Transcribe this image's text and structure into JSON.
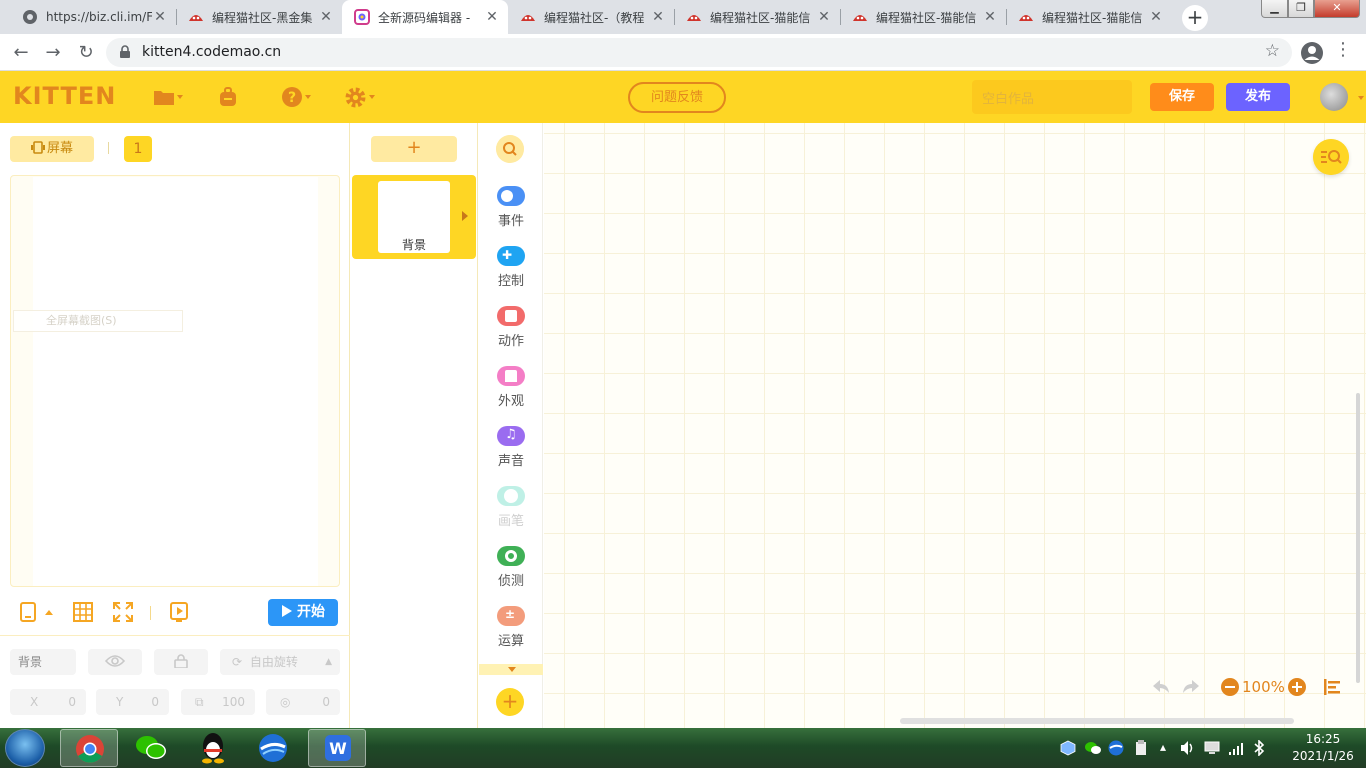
{
  "browser": {
    "tabs": [
      {
        "title": "https://biz.cli.im/F",
        "favicon": "globe-icon",
        "active": false
      },
      {
        "title": "编程猫社区-黑金集",
        "favicon": "codemao-icon",
        "active": false
      },
      {
        "title": "全新源码编辑器 - ",
        "favicon": "kitten-icon",
        "active": true
      },
      {
        "title": "编程猫社区-（教程",
        "favicon": "codemao-icon",
        "active": false
      },
      {
        "title": "编程猫社区-猫能信",
        "favicon": "codemao-icon",
        "active": false
      },
      {
        "title": "编程猫社区-猫能信",
        "favicon": "codemao-icon",
        "active": false
      },
      {
        "title": "编程猫社区-猫能信",
        "favicon": "codemao-icon",
        "active": false
      }
    ],
    "url": "kitten4.codemao.cn"
  },
  "header": {
    "logo": "KITTEN",
    "feedback_label": "问题反馈",
    "title_placeholder": "空白作品",
    "save_label": "保存",
    "publish_label": "发布"
  },
  "stage": {
    "screen_label": "屏幕",
    "page_number": "1",
    "fullscreen_tip": "全屏幕截图(S)",
    "start_label": "开始"
  },
  "props": {
    "name": "背景",
    "rotate_label": "自由旋转",
    "x_label": "X",
    "x_value": "0",
    "y_label": "Y",
    "y_value": "0",
    "size_value": "100",
    "angle_value": "0"
  },
  "sprites": {
    "add_label": "+",
    "items": [
      {
        "name": "背景"
      }
    ]
  },
  "categories": {
    "items": [
      {
        "label": "事件",
        "color": "#4a90f5"
      },
      {
        "label": "控制",
        "color": "#1fa4f2"
      },
      {
        "label": "动作",
        "color": "#f26b6b"
      },
      {
        "label": "外观",
        "color": "#f47ec6"
      },
      {
        "label": "声音",
        "color": "#9a6cf0"
      },
      {
        "label": "画笔",
        "color": "#bff0e6"
      },
      {
        "label": "侦测",
        "color": "#3fb056"
      },
      {
        "label": "运算",
        "color": "#f39c7c"
      }
    ],
    "add_label": "+"
  },
  "workspace": {
    "zoom": "100%"
  },
  "taskbar": {
    "time": "16:25",
    "date": "2021/1/26"
  },
  "colors": {
    "accent_yellow": "#fed624",
    "accent_orange": "#e2861e",
    "save": "#ff8c1a",
    "publish": "#6c63ff",
    "start": "#2c96f7"
  }
}
